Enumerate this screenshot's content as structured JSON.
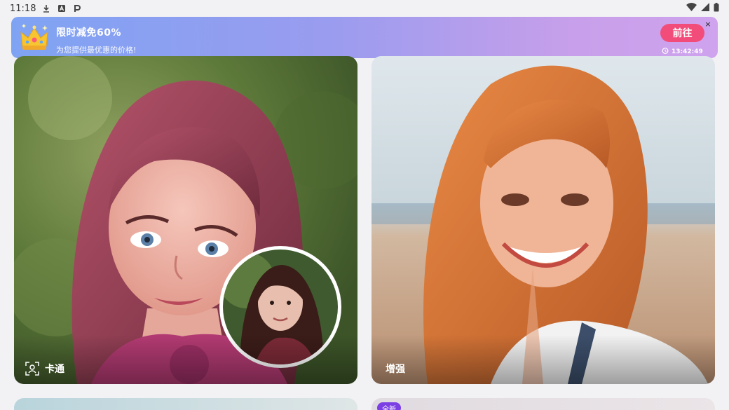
{
  "status_bar": {
    "time": "11:18",
    "left_icons": [
      "download-icon",
      "font-icon",
      "parking-icon"
    ],
    "right_icons": [
      "wifi-icon",
      "signal-icon",
      "battery-icon"
    ]
  },
  "promo": {
    "title": "限时减免60%",
    "subtitle": "为您提供最优惠的价格!",
    "go_label": "前往",
    "close_label": "×",
    "countdown": "13:42:49",
    "colors": {
      "gradient_start": "#7fa3f3",
      "gradient_end": "#cfa3ee",
      "button": "#f24d7a"
    }
  },
  "cards": [
    {
      "label": "卡通",
      "icon": "face-scan-icon"
    },
    {
      "label": "增强",
      "icon": ""
    },
    {
      "label": "",
      "icon": ""
    },
    {
      "badge": "全新"
    }
  ]
}
